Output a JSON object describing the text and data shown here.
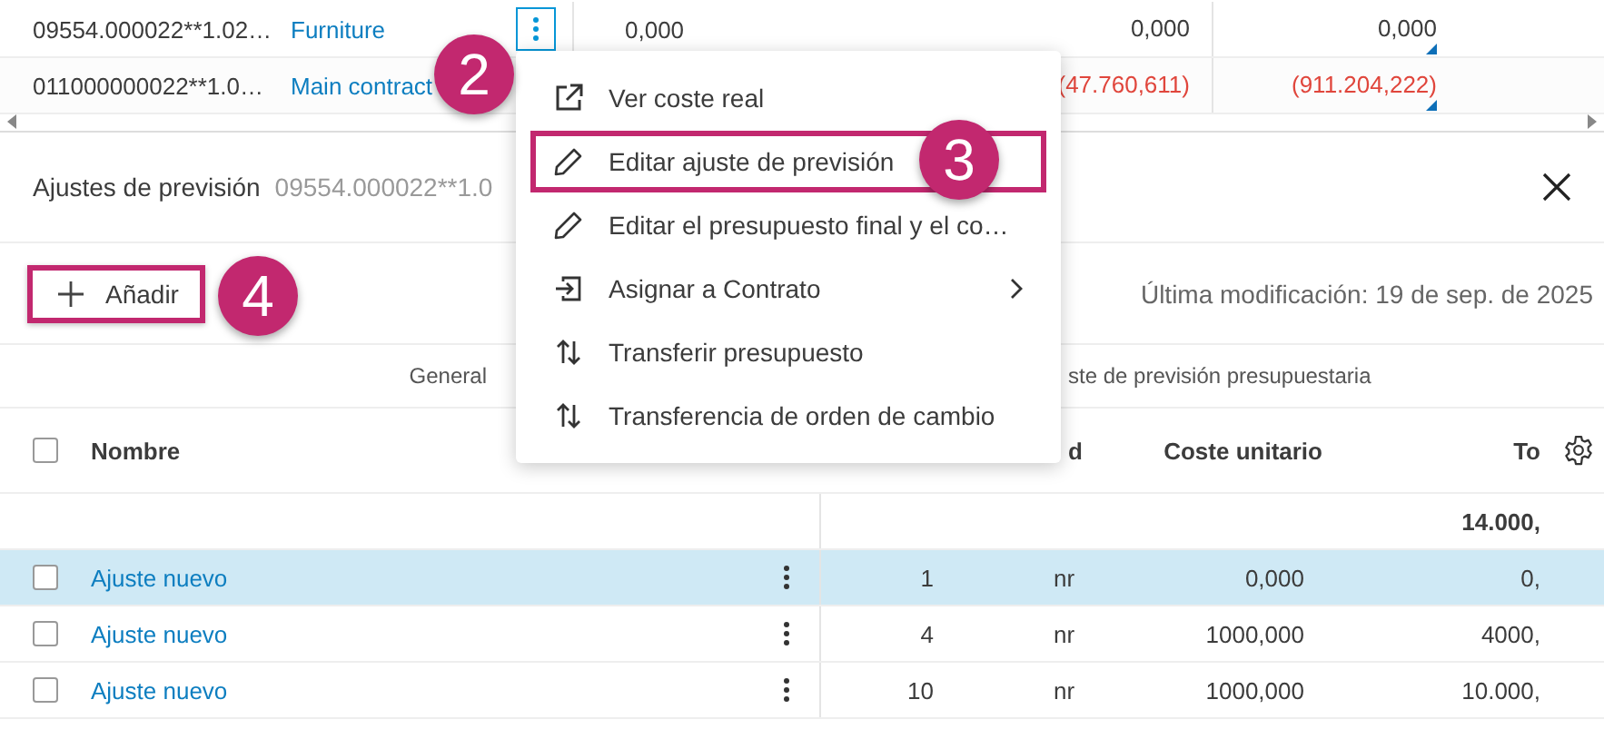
{
  "top_table": {
    "rows": [
      {
        "code": "09554.000022**1.02…",
        "name": "Furniture",
        "menu_active": true,
        "negative": false,
        "col_3": "0,000",
        "col_4": "0,000",
        "col_5": "0,000"
      },
      {
        "code": "011000000022**1.0…",
        "name": "Main contract",
        "negative": true,
        "col_4": "(47.760,611)",
        "col_5": "(911.204,222)"
      }
    ]
  },
  "panel": {
    "title": "Ajustes de previsión",
    "subtitle": "09554.000022**1.0"
  },
  "toolbar": {
    "add_button": {
      "label": "Añadir",
      "framed": true
    },
    "last_modified": "Última modificación: 19 de sep. de 2025"
  },
  "table": {
    "group_headers": [
      "General",
      "ste de previsión presupuestaria"
    ],
    "select_all_checked": false,
    "columns": [
      "Nombre",
      "d",
      "Coste unitario",
      "To"
    ],
    "total": "14.000,",
    "rows": [
      {
        "name": "Ajuste nuevo",
        "quantity": "1",
        "unit": "nr",
        "unit_cost": "0,000",
        "total": "0,",
        "selected": true,
        "checked": false
      },
      {
        "name": "Ajuste nuevo",
        "quantity": "4",
        "unit": "nr",
        "unit_cost": "1000,000",
        "total": "4000,",
        "selected": false,
        "checked": false
      },
      {
        "name": "Ajuste nuevo",
        "quantity": "10",
        "unit": "nr",
        "unit_cost": "1000,000",
        "total": "10.000,",
        "selected": false,
        "checked": false
      }
    ]
  },
  "context_menu": {
    "items": [
      {
        "label": "Ver coste real",
        "kind": "external",
        "submenu": false,
        "framed": false
      },
      {
        "label": "Editar ajuste de previsión",
        "kind": "pencil",
        "submenu": false,
        "framed": true
      },
      {
        "label": "Editar el presupuesto final y el co…",
        "kind": "pencil",
        "submenu": false,
        "framed": false
      },
      {
        "label": "Asignar a Contrato",
        "kind": "assign",
        "submenu": true,
        "framed": false
      },
      {
        "label": "Transferir presupuesto",
        "kind": "transfer",
        "submenu": false,
        "framed": false
      },
      {
        "label": "Transferencia de orden de cambio",
        "kind": "transfer",
        "submenu": false,
        "framed": false
      }
    ]
  },
  "callouts": [
    {
      "label": "2"
    },
    {
      "label": "3"
    },
    {
      "label": "4"
    }
  ]
}
